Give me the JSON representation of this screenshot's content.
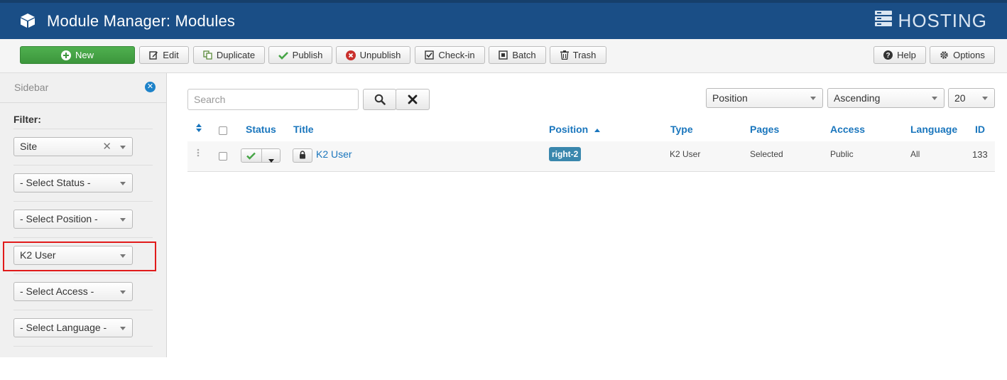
{
  "header": {
    "title": "Module Manager: Modules",
    "brand": "HOSTING"
  },
  "toolbar": {
    "new": "New",
    "edit": "Edit",
    "duplicate": "Duplicate",
    "publish": "Publish",
    "unpublish": "Unpublish",
    "checkin": "Check-in",
    "batch": "Batch",
    "trash": "Trash",
    "help": "Help",
    "options": "Options"
  },
  "sidebar": {
    "title": "Sidebar",
    "filter_label": "Filter:",
    "filters": {
      "site": "Site",
      "status": "- Select Status -",
      "position": "- Select Position -",
      "module": "K2 User",
      "access": "- Select Access -",
      "language": "- Select Language -"
    }
  },
  "search": {
    "placeholder": "Search",
    "value": ""
  },
  "sorting": {
    "order_by": "Position",
    "direction": "Ascending",
    "limit": "20"
  },
  "table": {
    "headers": {
      "status": "Status",
      "title": "Title",
      "position": "Position",
      "type": "Type",
      "pages": "Pages",
      "access": "Access",
      "language": "Language",
      "id": "ID"
    },
    "rows": [
      {
        "title": "K2 User",
        "position": "right-2",
        "type": "K2 User",
        "pages": "Selected",
        "access": "Public",
        "language": "All",
        "id": "133"
      }
    ]
  },
  "colors": {
    "header_bg": "#1a4e86",
    "new_button": "#46a546",
    "link": "#1a76bd",
    "badge": "#3a87ad",
    "highlight": "#e11b1b"
  }
}
